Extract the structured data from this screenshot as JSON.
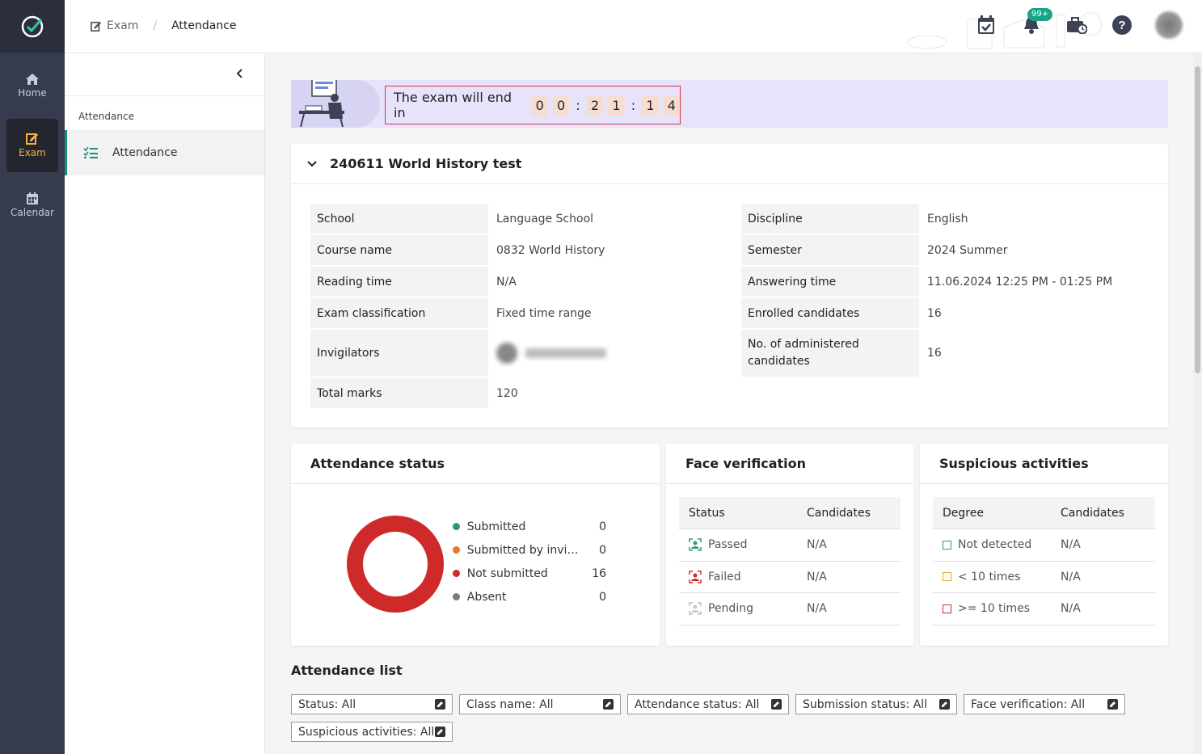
{
  "rail": {
    "items": [
      {
        "label": "Home",
        "icon": "home-icon"
      },
      {
        "label": "Exam",
        "icon": "exam-icon"
      },
      {
        "label": "Calendar",
        "icon": "calendar-icon"
      }
    ]
  },
  "header": {
    "breadcrumb_root": "Exam",
    "breadcrumb_current": "Attendance",
    "notification_badge": "99+"
  },
  "subsidebar": {
    "section_label": "Attendance",
    "item_label": "Attendance"
  },
  "banner": {
    "text": "The exam will end in",
    "digits": [
      "0",
      "0",
      "2",
      "1",
      "1",
      "4"
    ],
    "separator": ":"
  },
  "exam": {
    "title": "240611 World History test",
    "left": [
      {
        "key": "School",
        "value": "Language School"
      },
      {
        "key": "Course name",
        "value": "0832 World History"
      },
      {
        "key": "Reading time",
        "value": "N/A"
      },
      {
        "key": "Exam classification",
        "value": "Fixed time range"
      },
      {
        "key": "Invigilators",
        "value": ""
      },
      {
        "key": "Total marks",
        "value": "120"
      }
    ],
    "right": [
      {
        "key": "Discipline",
        "value": "English"
      },
      {
        "key": "Semester",
        "value": "2024 Summer"
      },
      {
        "key": "Answering time",
        "value": "11.06.2024 12:25 PM - 01:25 PM"
      },
      {
        "key": "Enrolled candidates",
        "value": "16"
      },
      {
        "key": "No. of administered candidates",
        "value": "16"
      }
    ]
  },
  "attendance_status": {
    "title": "Attendance status",
    "legend": [
      {
        "label": "Submitted",
        "count": "0",
        "color": "#2e9a6b"
      },
      {
        "label": "Submitted by invigil...",
        "count": "0",
        "color": "#e8792a"
      },
      {
        "label": "Not submitted",
        "count": "16",
        "color": "#cf2a2a"
      },
      {
        "label": "Absent",
        "count": "0",
        "color": "#7b7b7b"
      }
    ],
    "chart_color": "#cf2a2a"
  },
  "face_verification": {
    "title": "Face verification",
    "col1": "Status",
    "col2": "Candidates",
    "rows": [
      {
        "label": "Passed",
        "value": "N/A",
        "color": "#2e9a6b"
      },
      {
        "label": "Failed",
        "value": "N/A",
        "color": "#cf2a2a"
      },
      {
        "label": "Pending",
        "value": "N/A",
        "color": "#bbbbbb"
      }
    ]
  },
  "suspicious": {
    "title": "Suspicious activities",
    "col1": "Degree",
    "col2": "Candidates",
    "rows": [
      {
        "label": "Not detected",
        "value": "N/A",
        "color": "#2e9a6b"
      },
      {
        "label": "< 10 times",
        "value": "N/A",
        "color": "#e8a02a"
      },
      {
        "label": ">= 10 times",
        "value": "N/A",
        "color": "#cf2a2a"
      }
    ]
  },
  "attendance_list": {
    "title": "Attendance list",
    "filters": [
      "Status: All",
      "Class name: All",
      "Attendance status: All",
      "Submission status: All",
      "Face verification: All",
      "Suspicious activities: All"
    ]
  }
}
